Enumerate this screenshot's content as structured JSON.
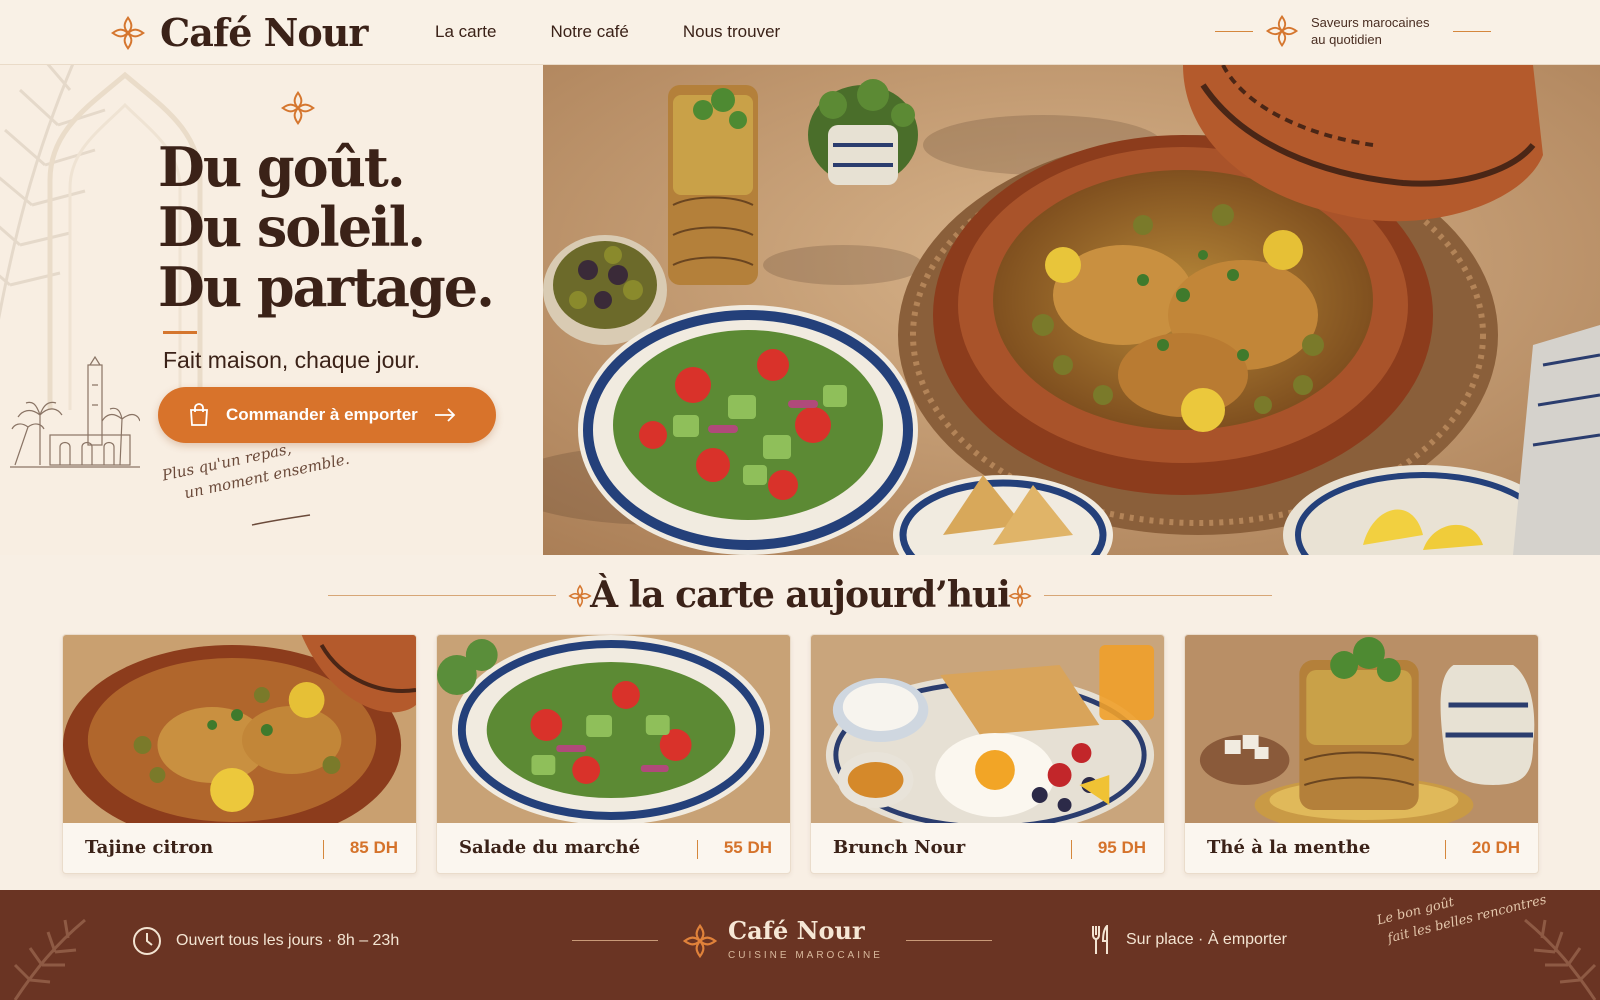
{
  "header": {
    "brand": "Café Nour",
    "nav": [
      "La carte",
      "Notre café",
      "Nous trouver"
    ],
    "tagline_line1": "Saveurs marocaines",
    "tagline_line2": "au quotidien"
  },
  "hero": {
    "title_lines": [
      "Du goût.",
      "Du soleil.",
      "Du partage."
    ],
    "subtitle": "Fait maison, chaque jour.",
    "cta_label": "Commander à emporter",
    "script_line1": "Plus qu'un repas,",
    "script_line2": "un moment ensemble."
  },
  "menu": {
    "heading": "À la carte aujourd’hui",
    "items": [
      {
        "name": "Tajine citron",
        "price": "85 DH"
      },
      {
        "name": "Salade du marché",
        "price": "55 DH"
      },
      {
        "name": "Brunch Nour",
        "price": "95 DH"
      },
      {
        "name": "Thé à la menthe",
        "price": "20 DH"
      }
    ]
  },
  "footer": {
    "hours": "Ouvert tous les jours · 8h – 23h",
    "brand": "Café Nour",
    "brand_sub": "CUISINE MAROCAINE",
    "service": "Sur place · À emporter",
    "script_line1": "Le bon goût",
    "script_line2": "fait les belles rencontres"
  },
  "colors": {
    "accent": "#d8732b",
    "text_dark": "#3b2218",
    "background": "#f8efe4",
    "footer_bg": "#6a3423"
  },
  "icons": [
    "quatrefoil-icon",
    "shopping-bag-icon",
    "arrow-right-icon",
    "clock-icon",
    "fork-knife-icon",
    "palm-leaf-icon"
  ]
}
